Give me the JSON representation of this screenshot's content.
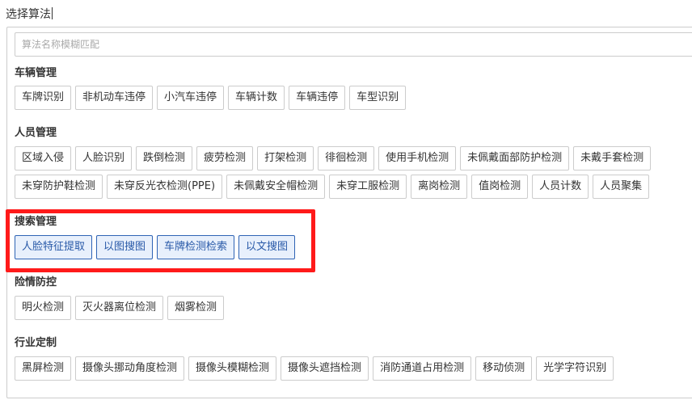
{
  "page": {
    "title": "选择算法"
  },
  "search": {
    "placeholder": "算法名称模糊匹配",
    "value": ""
  },
  "sections": [
    {
      "title": "车辆管理",
      "rows": [
        [
          "车牌识别",
          "非机动车违停",
          "小汽车违停",
          "车辆计数",
          "车辆违停",
          "车型识别"
        ]
      ]
    },
    {
      "title": "人员管理",
      "rows": [
        [
          "区域入侵",
          "人脸识别",
          "跌倒检测",
          "疲劳检测",
          "打架检测",
          "徘徊检测",
          "使用手机检测",
          "未佩戴面部防护检测",
          "未戴手套检测"
        ],
        [
          "未穿防护鞋检测",
          "未穿反光衣检测(PPE)",
          "未佩戴安全帽检测",
          "未穿工服检测",
          "离岗检测",
          "值岗检测",
          "人员计数",
          "人员聚集"
        ]
      ]
    },
    {
      "title": "搜索管理",
      "rows": [
        [
          "人脸特征提取",
          "以图搜图",
          "车牌检测检索",
          "以文搜图"
        ]
      ]
    },
    {
      "title": "险情防控",
      "rows": [
        [
          "明火检测",
          "灭火器离位检测",
          "烟雾检测"
        ]
      ]
    },
    {
      "title": "行业定制",
      "rows": [
        [
          "黑屏检测",
          "摄像头挪动角度检测",
          "摄像头模糊检测",
          "摄像头遮挡检测",
          "消防通道占用检测",
          "移动侦测",
          "光学字符识别"
        ]
      ]
    }
  ],
  "colors": {
    "highlight": "#ff1a1a",
    "selected_border": "#2f64b5",
    "selected_text": "#2859a8"
  }
}
